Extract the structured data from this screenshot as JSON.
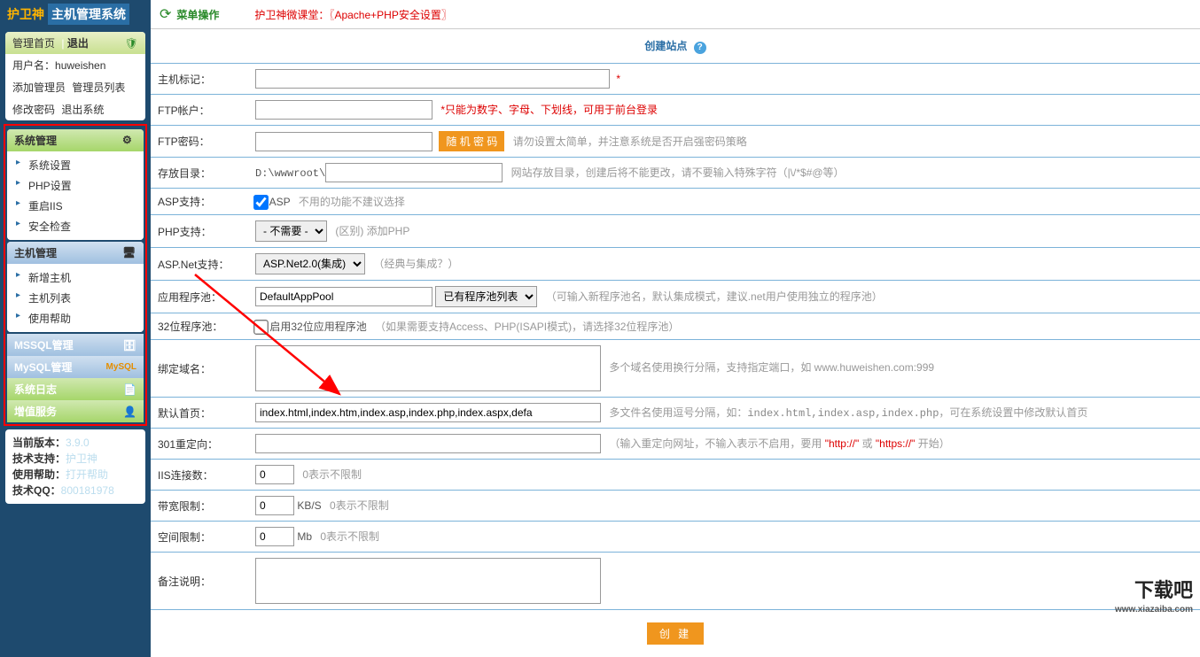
{
  "brand": {
    "name": "护卫神",
    "sub": "主机管理系统"
  },
  "topnav": {
    "home": "管理首页",
    "sep": "|",
    "logout": "退出",
    "user_label": "用户名：",
    "user_value": "huweishen",
    "add_admin": "添加管理员",
    "admin_list": "管理员列表",
    "change_pwd": "修改密码",
    "exit_sys": "退出系统"
  },
  "groups": {
    "sys": {
      "title": "系统管理",
      "items": [
        "系统设置",
        "PHP设置",
        "重启IIS",
        "安全检查"
      ]
    },
    "host": {
      "title": "主机管理",
      "items": [
        "新增主机",
        "主机列表",
        "使用帮助"
      ]
    },
    "mssql": "MSSQL管理",
    "mysql": "MySQL管理",
    "syslog": "系统日志",
    "vas": "增值服务"
  },
  "footer_info": {
    "version_label": "当前版本：",
    "version": "3.9.0",
    "support_label": "技术支持：",
    "support": "护卫神",
    "help_label": "使用帮助：",
    "help": "打开帮助",
    "qq_label": "技术QQ：",
    "qq": "800181978"
  },
  "topbar": {
    "menu_op": "菜单操作",
    "lesson_prefix": "护卫神微课堂：",
    "lesson_link": "〖Apache+PHP安全设置〗"
  },
  "page_title": "创建站点",
  "form": {
    "host_id": {
      "label": "主机标记：",
      "value": "",
      "req": "*"
    },
    "ftp_user": {
      "label": "FTP帐户：",
      "value": "",
      "hint": "*只能为数字、字母、下划线，可用于前台登录"
    },
    "ftp_pwd": {
      "label": "FTP密码：",
      "value": "",
      "btn": "随 机 密 码",
      "hint": "请勿设置太简单，并注意系统是否开启强密码策略"
    },
    "save_dir": {
      "label": "存放目录：",
      "prefix": "D:\\wwwroot\\",
      "value": "",
      "hint": "网站存放目录，创建后将不能更改，请不要输入特殊字符（|\\/*$#@等）"
    },
    "asp": {
      "label": "ASP支持：",
      "text": "ASP",
      "hint": "不用的功能不建议选择"
    },
    "php": {
      "label": "PHP支持：",
      "value": "- 不需要 -",
      "hint": "(区别) 添加PHP"
    },
    "aspnet": {
      "label": "ASP.Net支持：",
      "value": "ASP.Net2.0(集成)",
      "hint": "（经典与集成？）"
    },
    "apppool": {
      "label": "应用程序池：",
      "value": "DefaultAppPool",
      "select": "已有程序池列表",
      "hint": "（可输入新程序池名，默认集成模式，建议.net用户使用独立的程序池）"
    },
    "pool32": {
      "label": "32位程序池：",
      "cb": "启用32位应用程序池",
      "hint": "（如果需要支持Access、PHP(ISAPI模式)，请选择32位程序池）"
    },
    "domain": {
      "label": "绑定域名：",
      "value": "",
      "hint": "多个域名使用换行分隔，支持指定端口，如 www.huweishen.com:999"
    },
    "default_page": {
      "label": "默认首页：",
      "value": "index.html,index.htm,index.asp,index.php,index.aspx,defa",
      "hint_pre": "多文件名使用逗号分隔，如：",
      "hint_code": "index.html,index.asp,index.php",
      "hint_post": "，可在系统设置中修改默认首页"
    },
    "redirect": {
      "label": "301重定向：",
      "value": "",
      "hint_pre": "（输入重定向网址，不输入表示不启用，要用 ",
      "hint_a": "\"http://\"",
      "hint_mid": " 或 ",
      "hint_b": "\"https://\"",
      "hint_post": " 开始）"
    },
    "iis_conn": {
      "label": "IIS连接数：",
      "value": "0",
      "hint": "0表示不限制"
    },
    "bandwidth": {
      "label": "带宽限制：",
      "value": "0",
      "unit": "KB/S",
      "hint": "0表示不限制"
    },
    "space": {
      "label": "空间限制：",
      "value": "0",
      "unit": "Mb",
      "hint": "0表示不限制"
    },
    "remark": {
      "label": "备注说明：",
      "value": ""
    },
    "submit": "创  建"
  },
  "watermark": {
    "big": "下载吧",
    "small": "www.xiazaiba.com"
  }
}
